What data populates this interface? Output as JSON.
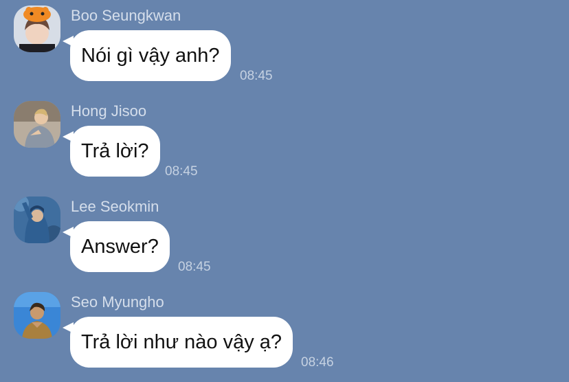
{
  "chat": {
    "messages": [
      {
        "sender": "Boo Seungkwan",
        "text": "Nói gì vậy anh?",
        "time": "08:45",
        "avatar_icon": "avatar-boo-seungkwan"
      },
      {
        "sender": "Hong Jisoo",
        "text": "Trả lời?",
        "time": "08:45",
        "avatar_icon": "avatar-hong-jisoo"
      },
      {
        "sender": "Lee Seokmin",
        "text": "Answer?",
        "time": "08:45",
        "avatar_icon": "avatar-lee-seokmin"
      },
      {
        "sender": "Seo Myungho",
        "text": "Trả lời như nào vậy ạ?",
        "time": "08:46",
        "avatar_icon": "avatar-seo-myungho"
      }
    ]
  },
  "colors": {
    "background": "#6784ad",
    "bubble": "#ffffff",
    "sender_name": "#d5deeb",
    "timestamp": "#c6d2e2"
  }
}
